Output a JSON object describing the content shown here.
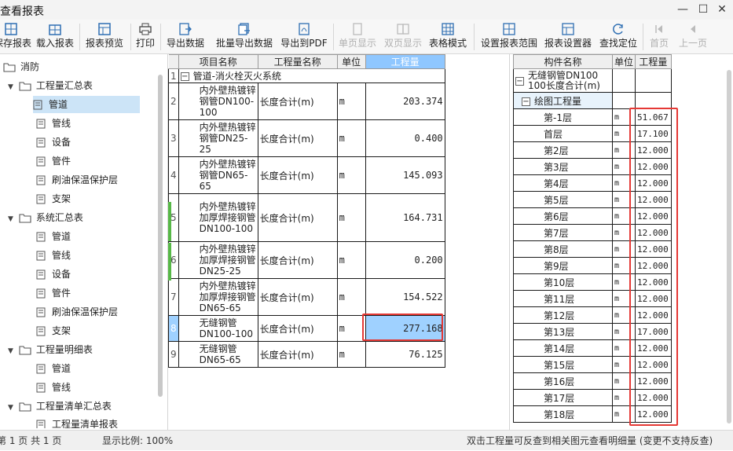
{
  "window": {
    "title": "查看报表",
    "minimize": "—",
    "maximize": "☐",
    "close": "✕"
  },
  "toolbar": [
    {
      "label": "保存报表",
      "icon": "grid-save-icon",
      "enabled": true
    },
    {
      "label": "载入报表",
      "icon": "grid-load-icon",
      "enabled": true
    },
    {
      "label": "报表预览",
      "icon": "grid-preview-icon",
      "enabled": true
    },
    {
      "label": "打印",
      "icon": "printer-icon",
      "enabled": true
    },
    {
      "label": "导出数据",
      "icon": "export-data-icon",
      "enabled": true
    },
    {
      "label": "批量导出数据",
      "icon": "batch-export-icon",
      "enabled": true
    },
    {
      "label": "导出到PDF",
      "icon": "pdf-icon",
      "enabled": true
    },
    {
      "label": "单页显示",
      "icon": "single-page-icon",
      "enabled": false
    },
    {
      "label": "双页显示",
      "icon": "double-page-icon",
      "enabled": false
    },
    {
      "label": "表格模式",
      "icon": "table-mode-icon",
      "enabled": true
    },
    {
      "label": "设置报表范围",
      "icon": "range-icon",
      "enabled": true
    },
    {
      "label": "报表设置器",
      "icon": "settings-grid-icon",
      "enabled": true
    },
    {
      "label": "查找定位",
      "icon": "locate-icon",
      "enabled": true
    },
    {
      "label": "首页",
      "icon": "first-page-icon",
      "enabled": false
    },
    {
      "label": "上一页",
      "icon": "prev-page-icon",
      "enabled": false
    }
  ],
  "tree": {
    "root": "消防",
    "groups": [
      {
        "label": "工程量汇总表",
        "items": [
          "管道",
          "管线",
          "设备",
          "管件",
          "刷油保温保护层",
          "支架"
        ]
      },
      {
        "label": "系统汇总表",
        "items": [
          "管道",
          "管线",
          "设备",
          "管件",
          "刷油保温保护层",
          "支架"
        ]
      },
      {
        "label": "工程量明细表",
        "items": [
          "管道",
          "管线"
        ]
      },
      {
        "label": "工程量清单汇总表",
        "items": [
          "工程量清单报表"
        ]
      }
    ],
    "selected": "工程量汇总表/管道"
  },
  "report": {
    "headers": [
      "项目名称",
      "工程量名称",
      "单位",
      "工程量"
    ],
    "group_row": {
      "num": "1",
      "label": "管道-消火栓灭火系统"
    },
    "rows": [
      {
        "num": "2",
        "name": "内外壁热镀锌钢管DN100-100",
        "qty_name": "长度合计(m)",
        "unit": "m",
        "value": "203.374"
      },
      {
        "num": "3",
        "name": "内外壁热镀锌钢管DN25-25",
        "qty_name": "长度合计(m)",
        "unit": "m",
        "value": "0.400"
      },
      {
        "num": "4",
        "name": "内外壁热镀锌钢管DN65-65",
        "qty_name": "长度合计(m)",
        "unit": "m",
        "value": "145.093"
      },
      {
        "num": "5",
        "name": "内外壁热镀锌加厚焊接钢管DN100-100",
        "qty_name": "长度合计(m)",
        "unit": "m",
        "value": "164.731"
      },
      {
        "num": "6",
        "name": "内外壁热镀锌加厚焊接钢管DN25-25",
        "qty_name": "长度合计(m)",
        "unit": "m",
        "value": "0.200"
      },
      {
        "num": "7",
        "name": "内外壁热镀锌加厚焊接钢管DN65-65",
        "qty_name": "长度合计(m)",
        "unit": "m",
        "value": "154.522"
      },
      {
        "num": "8",
        "name": "无缝钢管DN100-100",
        "qty_name": "长度合计(m)",
        "unit": "m",
        "value": "277.168"
      },
      {
        "num": "9",
        "name": "无缝钢管DN65-65",
        "qty_name": "长度合计(m)",
        "unit": "m",
        "value": "76.125"
      }
    ],
    "selected_row": "8"
  },
  "detail": {
    "headers": [
      "构件名称",
      "单位",
      "工程量"
    ],
    "component": "无缝钢管DN100 100长度合计(m)",
    "subgroup": "绘图工程量",
    "floors": [
      {
        "name": "第-1层",
        "unit": "m",
        "value": "51.067"
      },
      {
        "name": "首层",
        "unit": "m",
        "value": "17.100"
      },
      {
        "name": "第2层",
        "unit": "m",
        "value": "12.000"
      },
      {
        "name": "第3层",
        "unit": "m",
        "value": "12.000"
      },
      {
        "name": "第4层",
        "unit": "m",
        "value": "12.000"
      },
      {
        "name": "第5层",
        "unit": "m",
        "value": "12.000"
      },
      {
        "name": "第6层",
        "unit": "m",
        "value": "12.000"
      },
      {
        "name": "第7层",
        "unit": "m",
        "value": "12.000"
      },
      {
        "name": "第8层",
        "unit": "m",
        "value": "12.000"
      },
      {
        "name": "第9层",
        "unit": "m",
        "value": "12.000"
      },
      {
        "name": "第10层",
        "unit": "m",
        "value": "12.000"
      },
      {
        "name": "第11层",
        "unit": "m",
        "value": "12.000"
      },
      {
        "name": "第12层",
        "unit": "m",
        "value": "12.000"
      },
      {
        "name": "第13层",
        "unit": "m",
        "value": "17.000"
      },
      {
        "name": "第14层",
        "unit": "m",
        "value": "12.000"
      },
      {
        "name": "第15层",
        "unit": "m",
        "value": "12.000"
      },
      {
        "name": "第16层",
        "unit": "m",
        "value": "12.000"
      },
      {
        "name": "第17层",
        "unit": "m",
        "value": "12.000"
      },
      {
        "name": "第18层",
        "unit": "m",
        "value": "12.000"
      }
    ]
  },
  "status": {
    "page_info": "第 1 页  共 1 页",
    "scale": "显示比例: 100%",
    "hint": "双击工程量可反查到相关图元查看明细量 (变更不支持反查)"
  },
  "colors": {
    "highlight_header": "#8fc7ff",
    "selected_cell": "#9fd1ff",
    "annotation_red": "#e53935",
    "tree_selected": "#cce4f7"
  }
}
